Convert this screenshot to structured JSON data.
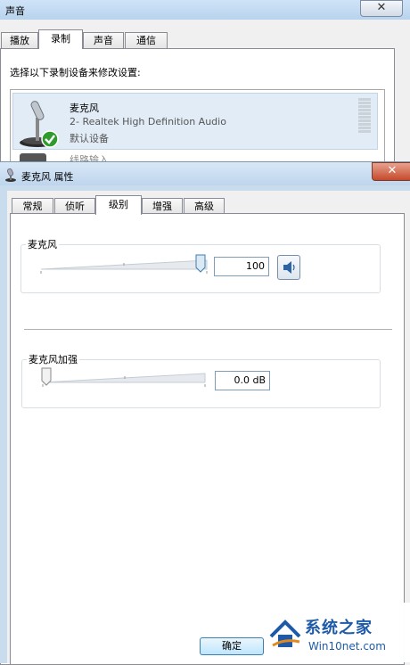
{
  "back_dialog": {
    "title": "声音",
    "close_glyph": "✕",
    "tabs": [
      "播放",
      "录制",
      "声音",
      "通信"
    ],
    "active_tab": 1,
    "instruction": "选择以下录制设备来修改设置:",
    "device": {
      "name": "麦克风",
      "description": "2- Realtek High Definition Audio",
      "status": "默认设备",
      "icon": "microphone-icon",
      "badge_icon": "checkmark-icon"
    },
    "device2_name_partial": "线路输入"
  },
  "front_dialog": {
    "title": "麦克风 属性",
    "close_glyph": "✕",
    "tabs": [
      "常规",
      "侦听",
      "级别",
      "增强",
      "高级"
    ],
    "active_tab": 2,
    "microphone": {
      "label": "麦克风",
      "value": "100",
      "level": 1.0,
      "mute_icon": "speaker-icon"
    },
    "boost": {
      "label": "麦克风加强",
      "value": "0.0 dB",
      "level": 0.0
    },
    "ok_button": "确定"
  },
  "watermark": {
    "brand": "系统之家",
    "site": "Win10net.com"
  },
  "colors": {
    "accent": "#3c7fb1",
    "close_red": "#c5492b",
    "check_green": "#2f9b2f",
    "watermark_blue": "#1e5aa8"
  }
}
